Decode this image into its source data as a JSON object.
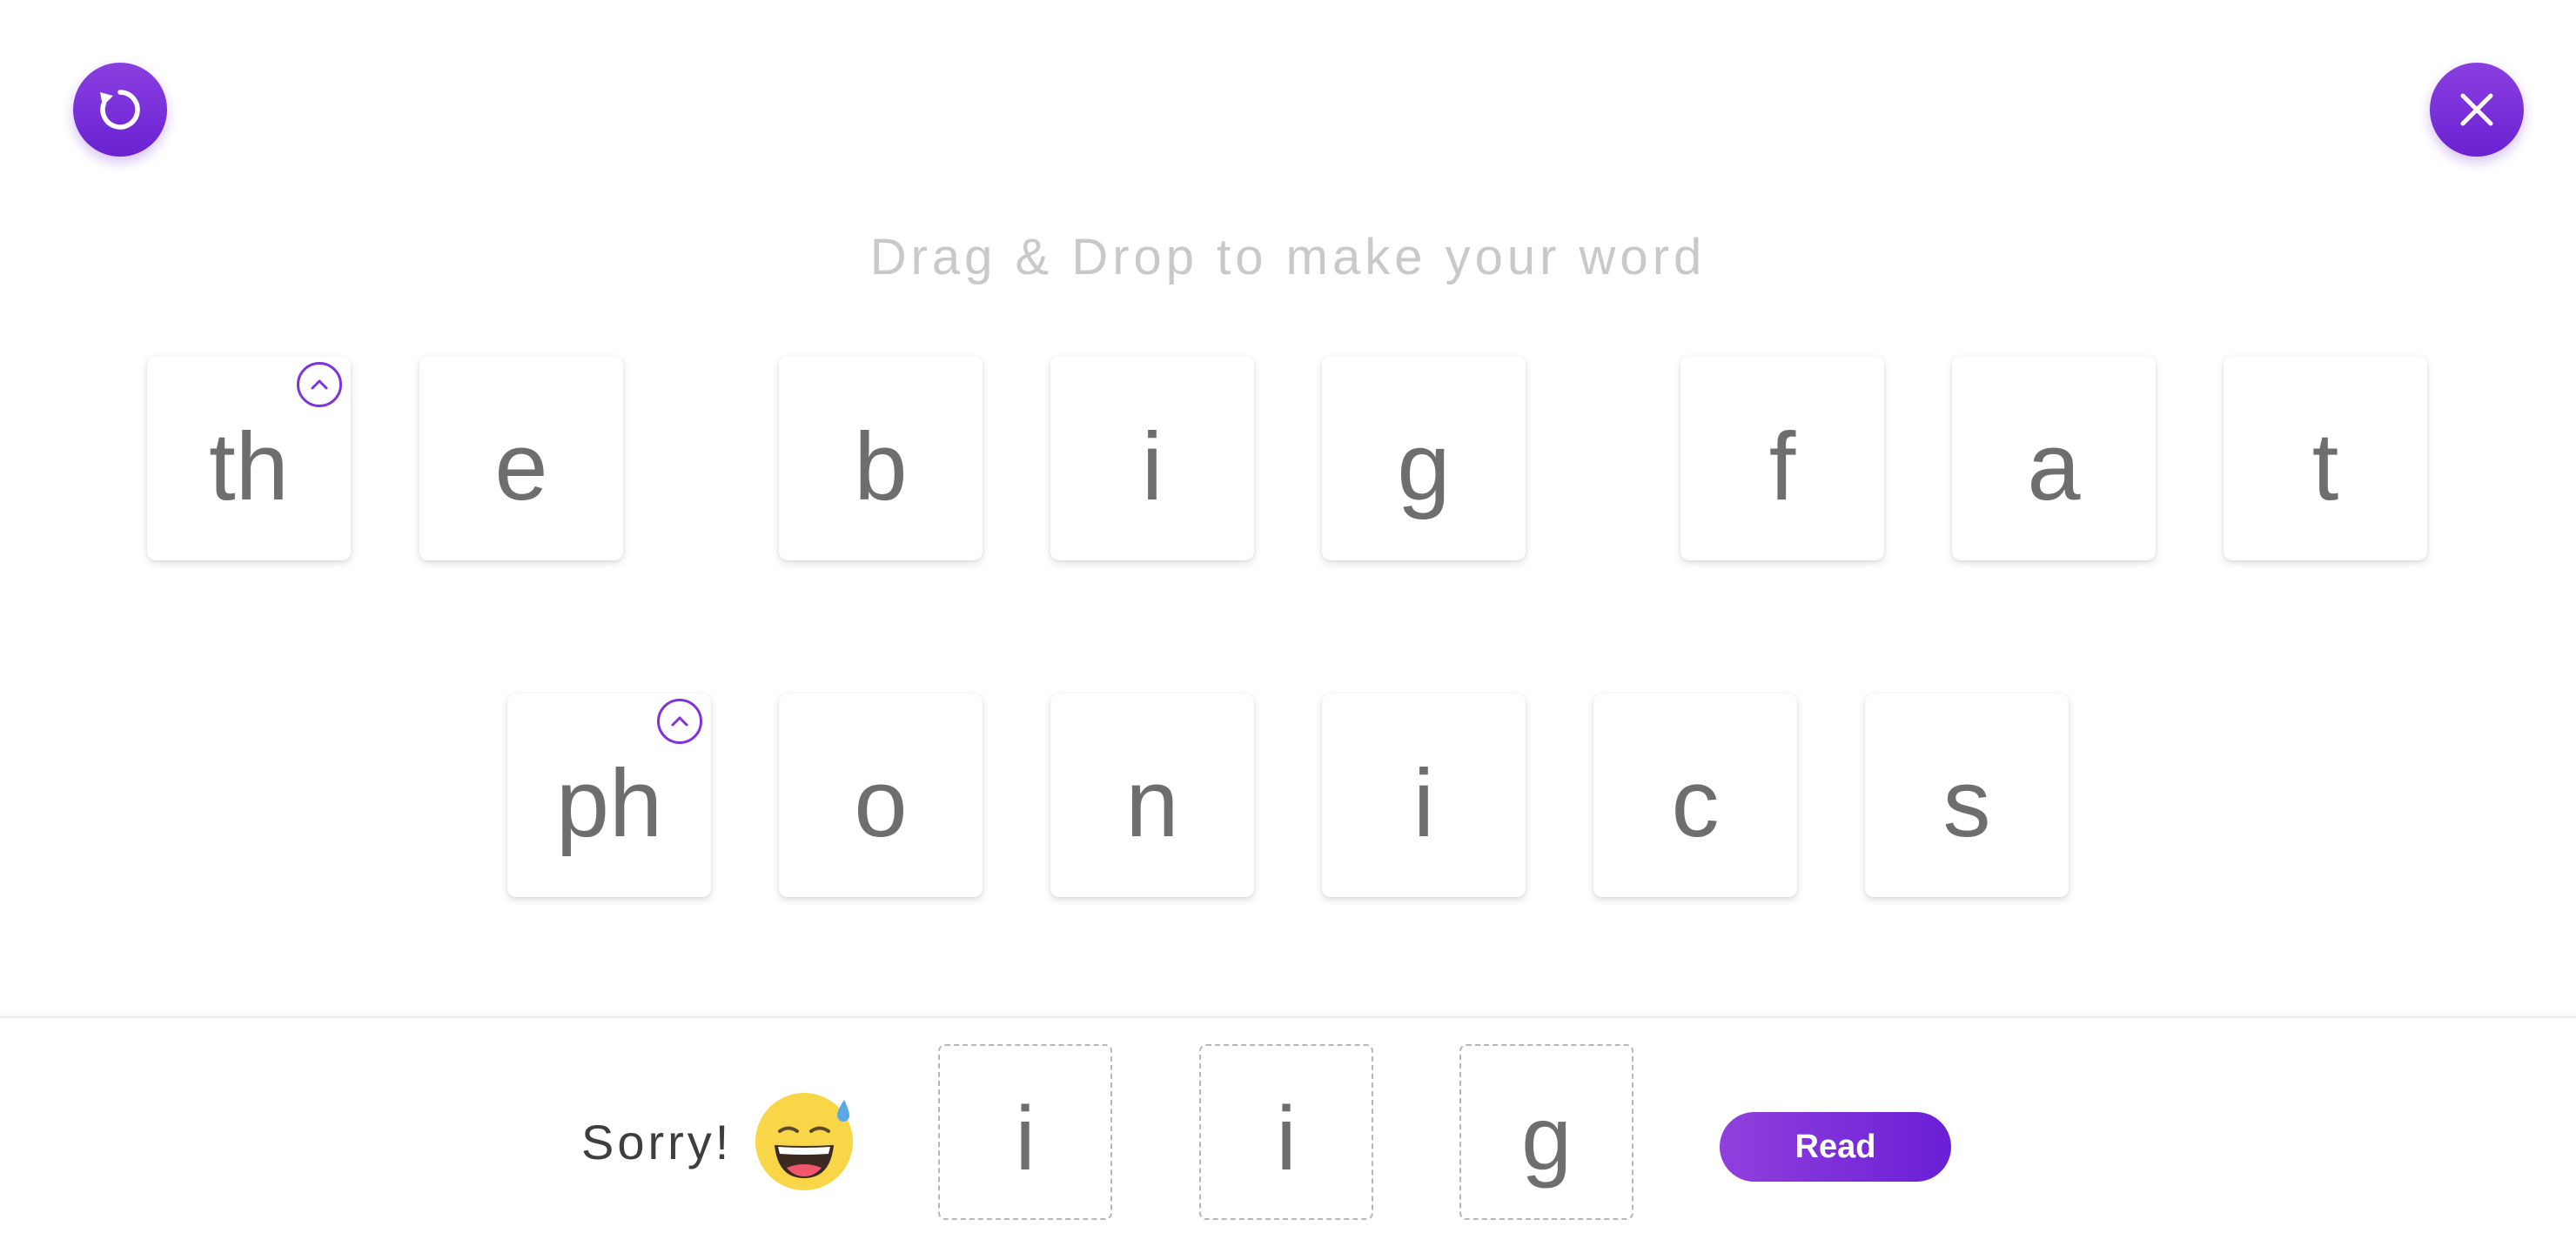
{
  "instruction": "Drag & Drop to make your word",
  "colors": {
    "accent": "#7b2fdc",
    "tile_text": "#6e6e6e",
    "instruction_text": "#c9c9c9"
  },
  "top_buttons": {
    "restart_icon": "restart-icon",
    "close_icon": "close-icon"
  },
  "tiles_row1": [
    "th",
    "e",
    "b",
    "i",
    "g",
    "f",
    "a",
    "t"
  ],
  "tiles_row2": [
    "ph",
    "o",
    "n",
    "i",
    "c",
    "s"
  ],
  "expandable_tiles": [
    "th",
    "ph"
  ],
  "answer": {
    "feedback": "Sorry!",
    "emoji": "sweat-smile-emoji",
    "slots": [
      "i",
      "i",
      "g"
    ],
    "read_label": "Read"
  }
}
